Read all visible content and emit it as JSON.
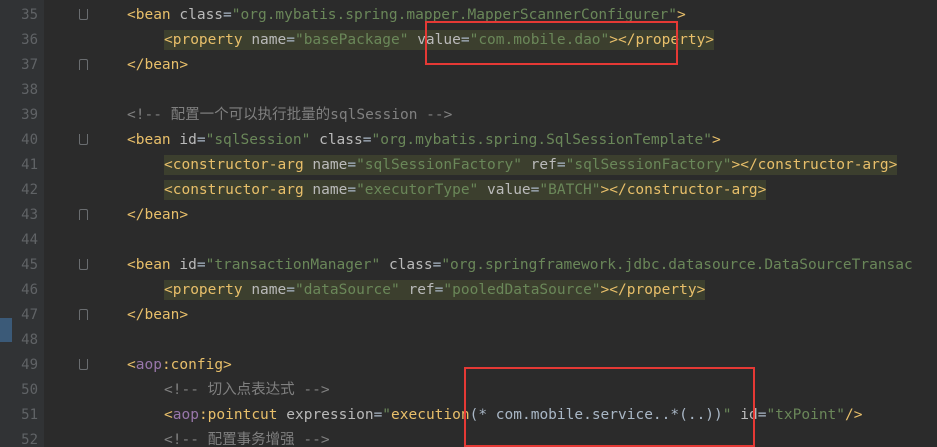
{
  "editor": {
    "lines": [
      {
        "num": "35",
        "indent": 1,
        "fold": "start",
        "tokens": [
          {
            "t": "<bean ",
            "c": "tag"
          },
          {
            "t": "class",
            "c": "attr"
          },
          {
            "t": "=",
            "c": "plain"
          },
          {
            "t": "\"org.mybatis.spring.mapper.MapperScannerConfigurer\"",
            "c": "str"
          },
          {
            "t": ">",
            "c": "tag"
          }
        ]
      },
      {
        "num": "36",
        "indent": 2,
        "fold": "",
        "hl": true,
        "tokens": [
          {
            "t": "<property ",
            "c": "tag"
          },
          {
            "t": "name",
            "c": "attr"
          },
          {
            "t": "=",
            "c": "plain"
          },
          {
            "t": "\"basePackage\"",
            "c": "str"
          },
          {
            "t": " ",
            "c": "plain"
          },
          {
            "t": "value",
            "c": "attr"
          },
          {
            "t": "=",
            "c": "plain"
          },
          {
            "t": "\"com.mobile.dao\"",
            "c": "str"
          },
          {
            "t": "></property>",
            "c": "tag"
          }
        ]
      },
      {
        "num": "37",
        "indent": 1,
        "fold": "end",
        "tokens": [
          {
            "t": "</bean>",
            "c": "tag"
          }
        ]
      },
      {
        "num": "38",
        "indent": 0,
        "fold": "",
        "tokens": []
      },
      {
        "num": "39",
        "indent": 1,
        "fold": "",
        "tokens": [
          {
            "t": "<!-- 配置一个可以执行批量的sqlSession -->",
            "c": "cmt"
          }
        ]
      },
      {
        "num": "40",
        "indent": 1,
        "fold": "start",
        "tokens": [
          {
            "t": "<bean ",
            "c": "tag"
          },
          {
            "t": "id",
            "c": "attr"
          },
          {
            "t": "=",
            "c": "plain"
          },
          {
            "t": "\"sqlSession\"",
            "c": "str"
          },
          {
            "t": " ",
            "c": "plain"
          },
          {
            "t": "class",
            "c": "attr"
          },
          {
            "t": "=",
            "c": "plain"
          },
          {
            "t": "\"org.mybatis.spring.SqlSessionTemplate\"",
            "c": "str"
          },
          {
            "t": ">",
            "c": "tag"
          }
        ]
      },
      {
        "num": "41",
        "indent": 2,
        "fold": "",
        "hl": true,
        "tokens": [
          {
            "t": "<constructor-arg ",
            "c": "tag"
          },
          {
            "t": "name",
            "c": "attr"
          },
          {
            "t": "=",
            "c": "plain"
          },
          {
            "t": "\"sqlSessionFactory\"",
            "c": "str"
          },
          {
            "t": " ",
            "c": "plain"
          },
          {
            "t": "ref",
            "c": "attr"
          },
          {
            "t": "=",
            "c": "plain"
          },
          {
            "t": "\"sqlSessionFactory\"",
            "c": "str"
          },
          {
            "t": "></constructor-arg>",
            "c": "tag"
          }
        ]
      },
      {
        "num": "42",
        "indent": 2,
        "fold": "",
        "hl": true,
        "tokens": [
          {
            "t": "<constructor-arg ",
            "c": "tag"
          },
          {
            "t": "name",
            "c": "attr"
          },
          {
            "t": "=",
            "c": "plain"
          },
          {
            "t": "\"executorType\"",
            "c": "str"
          },
          {
            "t": " ",
            "c": "plain"
          },
          {
            "t": "value",
            "c": "attr"
          },
          {
            "t": "=",
            "c": "plain"
          },
          {
            "t": "\"BATCH\"",
            "c": "str"
          },
          {
            "t": "></constructor-arg>",
            "c": "tag"
          }
        ]
      },
      {
        "num": "43",
        "indent": 1,
        "fold": "end",
        "tokens": [
          {
            "t": "</bean>",
            "c": "tag"
          }
        ]
      },
      {
        "num": "44",
        "indent": 0,
        "fold": "",
        "tokens": []
      },
      {
        "num": "45",
        "indent": 1,
        "fold": "start",
        "tokens": [
          {
            "t": "<bean ",
            "c": "tag"
          },
          {
            "t": "id",
            "c": "attr"
          },
          {
            "t": "=",
            "c": "plain"
          },
          {
            "t": "\"transactionManager\"",
            "c": "str"
          },
          {
            "t": " ",
            "c": "plain"
          },
          {
            "t": "class",
            "c": "attr"
          },
          {
            "t": "=",
            "c": "plain"
          },
          {
            "t": "\"org.springframework.jdbc.datasource.DataSourceTransac",
            "c": "str"
          }
        ]
      },
      {
        "num": "46",
        "indent": 2,
        "fold": "",
        "hl": true,
        "tokens": [
          {
            "t": "<property ",
            "c": "tag"
          },
          {
            "t": "name",
            "c": "attr"
          },
          {
            "t": "=",
            "c": "plain"
          },
          {
            "t": "\"dataSource\"",
            "c": "str"
          },
          {
            "t": " ",
            "c": "plain"
          },
          {
            "t": "ref",
            "c": "attr"
          },
          {
            "t": "=",
            "c": "plain"
          },
          {
            "t": "\"pooledDataSource\"",
            "c": "str"
          },
          {
            "t": "></property>",
            "c": "tag"
          }
        ]
      },
      {
        "num": "47",
        "indent": 1,
        "fold": "end",
        "tokens": [
          {
            "t": "</bean>",
            "c": "tag"
          }
        ]
      },
      {
        "num": "48",
        "indent": 0,
        "fold": "",
        "tokens": []
      },
      {
        "num": "49",
        "indent": 1,
        "fold": "start",
        "tokens": [
          {
            "t": "<",
            "c": "tag"
          },
          {
            "t": "aop",
            "c": "ns"
          },
          {
            "t": ":config>",
            "c": "tag"
          }
        ]
      },
      {
        "num": "50",
        "indent": 2,
        "fold": "",
        "tokens": [
          {
            "t": "<!-- 切入点表达式 -->",
            "c": "cmt"
          }
        ]
      },
      {
        "num": "51",
        "indent": 2,
        "fold": "",
        "tokens": [
          {
            "t": "<",
            "c": "tag"
          },
          {
            "t": "aop",
            "c": "ns"
          },
          {
            "t": ":pointcut ",
            "c": "tag"
          },
          {
            "t": "expression",
            "c": "attr"
          },
          {
            "t": "=",
            "c": "plain"
          },
          {
            "t": "\"",
            "c": "str"
          },
          {
            "t": "execution",
            "c": "fn"
          },
          {
            "t": "(* com.mobile.service..*(..))",
            "c": "plain"
          },
          {
            "t": "\"",
            "c": "str"
          },
          {
            "t": " ",
            "c": "plain"
          },
          {
            "t": "id",
            "c": "attr"
          },
          {
            "t": "=",
            "c": "plain"
          },
          {
            "t": "\"txPoint\"",
            "c": "str"
          },
          {
            "t": "/>",
            "c": "tag"
          }
        ]
      },
      {
        "num": "52",
        "indent": 2,
        "fold": "",
        "tokens": [
          {
            "t": "<!-- 配置事务增强 -->",
            "c": "cmt"
          }
        ]
      }
    ],
    "highlights": [
      {
        "name": "base-package-value-highlight"
      },
      {
        "name": "pointcut-expression-highlight"
      }
    ]
  }
}
